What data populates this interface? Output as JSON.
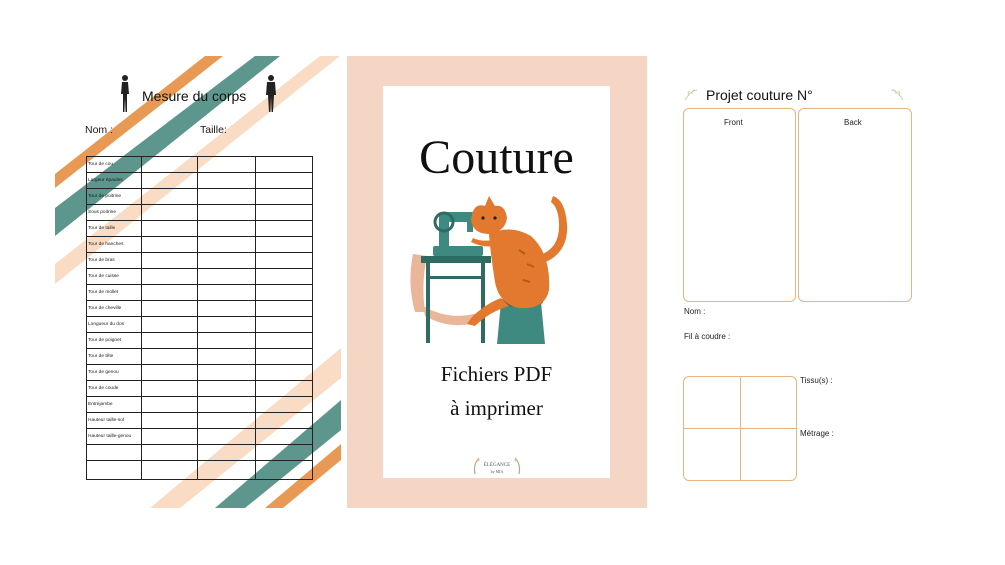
{
  "left_page": {
    "title": "Mesure du corps",
    "name_label": "Nom :",
    "size_label": "Taille:",
    "rows": [
      "Tour de cou",
      "Largeur épaules",
      "Tour de poitrine",
      "Sous poitrine",
      "Tour de taille",
      "Tour de hanches",
      "Tour de bras",
      "Tour de cuisse",
      "Tour de mollet",
      "Tour de cheville",
      "Longueur du dos",
      "Tour de poignet",
      "Tour de tête",
      "Tour de genou",
      "Tour de coude",
      "Entrejambe",
      "Hauteur taille-sol",
      "Hauteur taille-genou",
      "",
      ""
    ],
    "colors": {
      "orange": "#e89a55",
      "teal": "#5d968c",
      "peach": "#f9dcc3"
    }
  },
  "cover": {
    "title": "Couture",
    "subtitle_line1": "Fichiers PDF",
    "subtitle_line2": "à imprimer",
    "logo_text_1": "ÉLÉGANCE",
    "logo_text_2": "by MIA",
    "background": "#f5d5c3"
  },
  "right_page": {
    "title": "Projet couture N°",
    "front_label": "Front",
    "back_label": "Back",
    "name_label": "Nom :",
    "thread_label": "Fil à coudre :",
    "fabric_label": "Tissu(s) :",
    "length_label": "Métrage :",
    "border_color": "#e7b57f"
  }
}
